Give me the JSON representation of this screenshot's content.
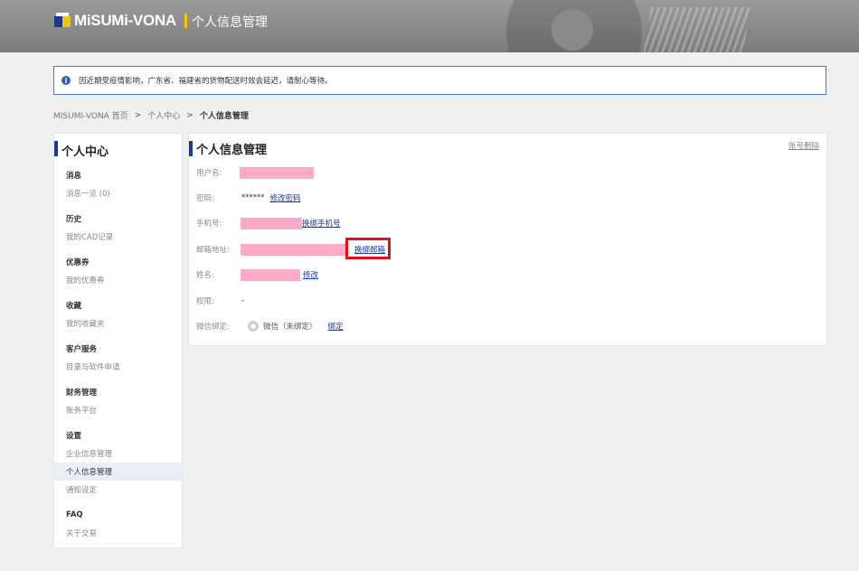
{
  "header": {
    "logo_text": "MiSUMi-VONA",
    "title": "个人信息管理",
    "accent_color": "#f5c400"
  },
  "notice": {
    "icon": "info-icon",
    "text": "因近期受疫情影响，广东省、福建省的货物配送时效会延迟，请耐心等待。"
  },
  "breadcrumb": {
    "items": [
      "MISUMI-VONA 首页",
      "个人中心",
      "个人信息管理"
    ],
    "separator": ">"
  },
  "sidebar": {
    "title": "个人中心",
    "groups": [
      {
        "heading": "消息",
        "items": [
          "消息一览 (0)"
        ]
      },
      {
        "heading": "历史",
        "items": [
          "我的CAD记录"
        ]
      },
      {
        "heading": "优惠券",
        "items": [
          "我的优惠券"
        ]
      },
      {
        "heading": "收藏",
        "items": [
          "我的收藏夹"
        ]
      },
      {
        "heading": "客户服务",
        "items": [
          "目录与软件申请"
        ]
      },
      {
        "heading": "财务管理",
        "items": [
          "账务平台"
        ]
      },
      {
        "heading": "设置",
        "items": [
          "企业信息管理",
          "个人信息管理",
          "通知设定"
        ]
      },
      {
        "heading": "FAQ",
        "items": [
          "关于交易"
        ]
      }
    ],
    "active_item": "个人信息管理"
  },
  "main": {
    "title": "个人信息管理",
    "delete_link": "账号删除",
    "fields": {
      "username_label": "用户名:",
      "password_label": "密码:",
      "password_value": "******",
      "password_link": "修改密码",
      "phone_label": "手机号:",
      "phone_link": "换绑手机号",
      "email_label": "邮箱地址:",
      "email_link": "换绑邮箱",
      "name_label": "姓名:",
      "name_link": "修改",
      "permission_label": "权限:",
      "permission_value": "-",
      "wechat_label": "微信绑定:",
      "wechat_status": "微信（未绑定）",
      "wechat_link": "绑定"
    },
    "redaction_color": "#ffaac8",
    "highlight_color": "#e0101c"
  }
}
